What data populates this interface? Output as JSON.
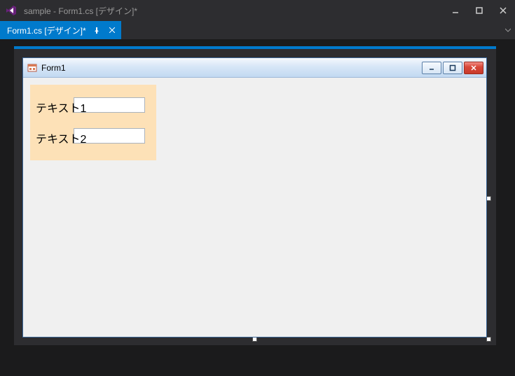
{
  "window": {
    "title": "sample - Form1.cs [デザイン]*"
  },
  "tab": {
    "label": "Form1.cs [デザイン]*"
  },
  "form": {
    "title": "Form1",
    "panel": {
      "label1": "テキスト1",
      "label2": "テキスト2",
      "textbox1_value": "",
      "textbox2_value": ""
    }
  }
}
